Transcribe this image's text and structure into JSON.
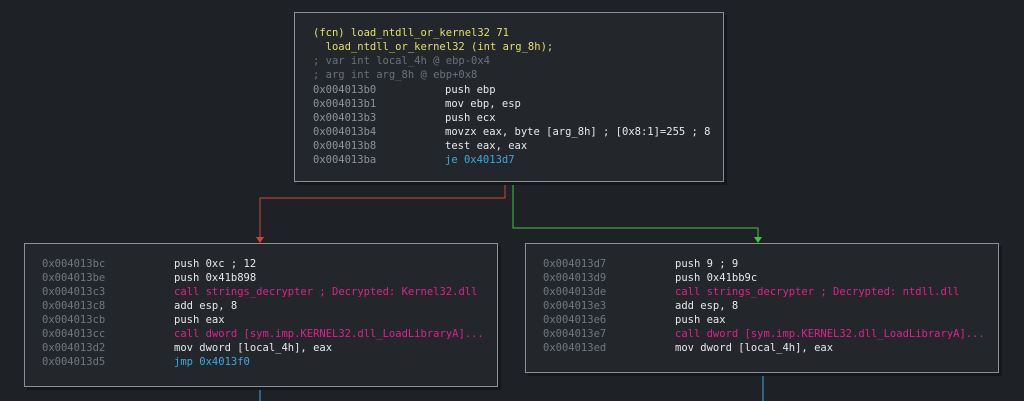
{
  "top_node": {
    "header1": "(fcn) load_ntdll_or_kernel32 71",
    "header2": "  load_ntdll_or_kernel32 (int arg_8h);",
    "comment1": "; var int local_4h @ ebp-0x4",
    "comment2": "; arg int arg_8h @ ebp+0x8",
    "rows": [
      {
        "addr": "0x004013b0",
        "ins": "push ebp"
      },
      {
        "addr": "0x004013b1",
        "ins": "mov ebp, esp"
      },
      {
        "addr": "0x004013b3",
        "ins": "push ecx"
      },
      {
        "addr": "0x004013b4",
        "ins": "movzx eax, byte [arg_8h] ; [0x8:1]=255 ; 8"
      },
      {
        "addr": "0x004013b8",
        "ins": "test eax, eax"
      },
      {
        "addr": "0x004013ba",
        "ins": "je 0x4013d7"
      }
    ]
  },
  "left_node": {
    "rows": [
      {
        "addr": "0x004013bc",
        "ins": "push 0xc ; 12"
      },
      {
        "addr": "0x004013be",
        "ins": "push 0x41b898"
      },
      {
        "addr": "0x004013c3",
        "ins": "call strings_decrypter ; Decrypted: Kernel32.dll"
      },
      {
        "addr": "0x004013c8",
        "ins": "add esp, 8"
      },
      {
        "addr": "0x004013cb",
        "ins": "push eax"
      },
      {
        "addr": "0x004013cc",
        "ins": "call dword [sym.imp.KERNEL32.dll_LoadLibraryA]..."
      },
      {
        "addr": "0x004013d2",
        "ins": "mov dword [local_4h], eax"
      },
      {
        "addr": "0x004013d5",
        "ins": "jmp 0x4013f0"
      }
    ]
  },
  "right_node": {
    "rows": [
      {
        "addr": "0x004013d7",
        "ins": "push 9 ; 9"
      },
      {
        "addr": "0x004013d9",
        "ins": "push 0x41bb9c"
      },
      {
        "addr": "0x004013de",
        "ins": "call strings_decrypter ; Decrypted: ntdll.dll"
      },
      {
        "addr": "0x004013e3",
        "ins": "add esp, 8"
      },
      {
        "addr": "0x004013e6",
        "ins": "push eax"
      },
      {
        "addr": "0x004013e7",
        "ins": "call dword [sym.imp.KERNEL32.dll_LoadLibraryA]..."
      },
      {
        "addr": "0x004013ed",
        "ins": "mov dword [local_4h], eax"
      }
    ]
  },
  "edge_colors": {
    "false_branch": "#d0462b",
    "true_branch": "#3dc43d",
    "continue": "#39aadf"
  }
}
